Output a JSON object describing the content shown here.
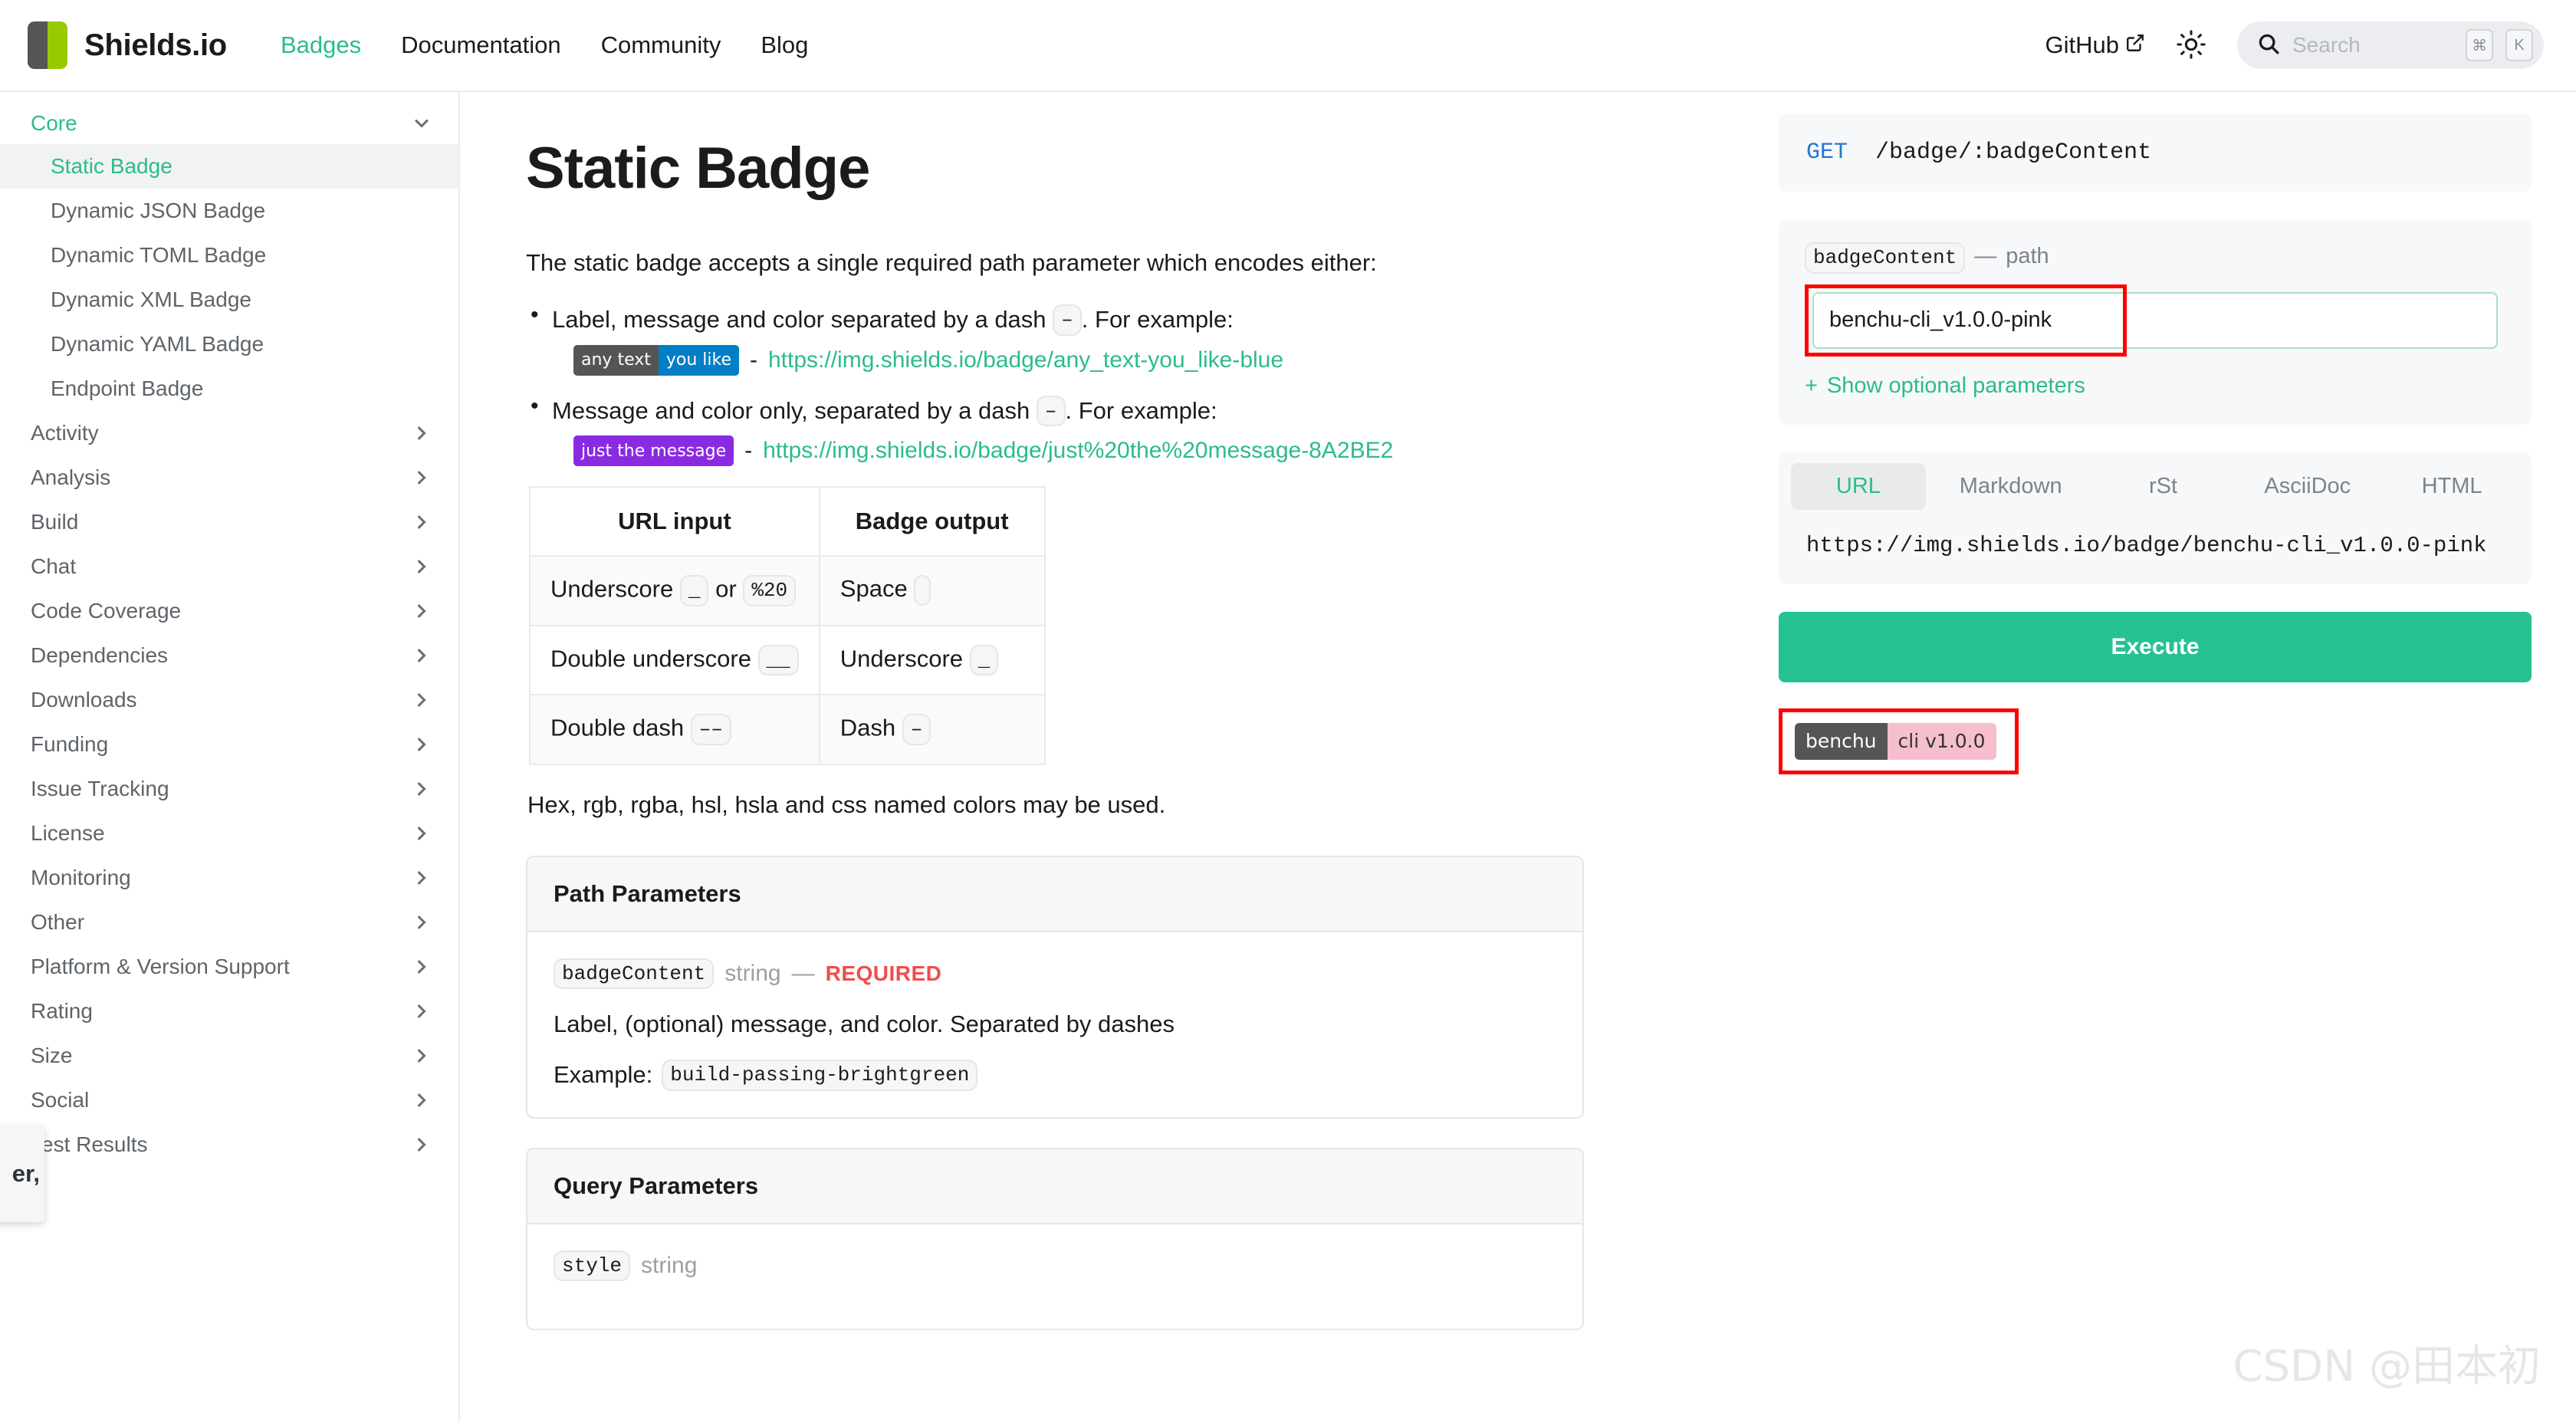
{
  "header": {
    "brand": "Shields.io",
    "nav": [
      {
        "label": "Badges",
        "active": true
      },
      {
        "label": "Documentation",
        "active": false
      },
      {
        "label": "Community",
        "active": false
      },
      {
        "label": "Blog",
        "active": false
      }
    ],
    "github_label": "GitHub",
    "search_placeholder": "Search",
    "kbd_cmd": "⌘",
    "kbd_k": "K"
  },
  "sidebar": {
    "group": {
      "label": "Core",
      "expanded": true
    },
    "items": [
      {
        "label": "Static Badge",
        "active": true
      },
      {
        "label": "Dynamic JSON Badge",
        "active": false
      },
      {
        "label": "Dynamic TOML Badge",
        "active": false
      },
      {
        "label": "Dynamic XML Badge",
        "active": false
      },
      {
        "label": "Dynamic YAML Badge",
        "active": false
      },
      {
        "label": "Endpoint Badge",
        "active": false
      }
    ],
    "categories": [
      "Activity",
      "Analysis",
      "Build",
      "Chat",
      "Code Coverage",
      "Dependencies",
      "Downloads",
      "Funding",
      "Issue Tracking",
      "License",
      "Monitoring",
      "Other",
      "Platform & Version Support",
      "Rating",
      "Size",
      "Social",
      "Test Results"
    ],
    "tooltip_fragment": "er,"
  },
  "main": {
    "title": "Static Badge",
    "lead": "The static badge accepts a single required path parameter which encodes either:",
    "bullets": [
      {
        "text_before": "Label, message and color separated by a dash",
        "code": "–",
        "text_after": ". For example:",
        "badge": {
          "type": "two-part",
          "left": "any text",
          "right": "you like",
          "left_color": "#555555",
          "right_color": "#007ec6"
        },
        "link": "https://img.shields.io/badge/any_text-you_like-blue"
      },
      {
        "text_before": "Message and color only, separated by a dash",
        "code": "–",
        "text_after": ". For example:",
        "badge": {
          "type": "one-part",
          "full": "just the message",
          "full_color": "#8a2be2"
        },
        "link": "https://img.shields.io/badge/just%20the%20message-8A2BE2"
      }
    ],
    "table": {
      "headers": [
        "URL input",
        "Badge output"
      ],
      "rows": [
        {
          "input_text": "Underscore",
          "input_code": "_",
          "input_or": "or",
          "input_code2": "%20",
          "output_text": "Space",
          "output_code": " "
        },
        {
          "input_text": "Double underscore",
          "input_code": "__",
          "input_or": "",
          "input_code2": "",
          "output_text": "Underscore",
          "output_code": "_"
        },
        {
          "input_text": "Double dash",
          "input_code": "––",
          "input_or": "",
          "input_code2": "",
          "output_text": "Dash",
          "output_code": "–"
        }
      ]
    },
    "note": "Hex, rgb, rgba, hsl, hsla and css named colors may be used.",
    "path_params": {
      "heading": "Path Parameters",
      "name": "badgeContent",
      "type": "string",
      "dash": "—",
      "required": "REQUIRED",
      "description": "Label, (optional) message, and color. Separated by dashes",
      "example_label": "Example:",
      "example_value": "build-passing-brightgreen"
    },
    "query_params": {
      "heading": "Query Parameters",
      "name": "style",
      "type": "string"
    }
  },
  "right_panel": {
    "endpoint": {
      "verb": "GET",
      "path": "/badge/:badgeContent"
    },
    "param": {
      "name": "badgeContent",
      "dash": "—",
      "kind": "path",
      "value": "benchu-cli_v1.0.0-pink",
      "show_optional": "Show optional parameters",
      "plus": "+"
    },
    "tabs": [
      {
        "label": "URL",
        "active": true
      },
      {
        "label": "Markdown",
        "active": false
      },
      {
        "label": "rSt",
        "active": false
      },
      {
        "label": "AsciiDoc",
        "active": false
      },
      {
        "label": "HTML",
        "active": false
      }
    ],
    "url_output": "https://img.shields.io/badge/benchu-cli_v1.0.0-pink",
    "execute_label": "Execute",
    "result_badge": {
      "left": "benchu",
      "right": "cli v1.0.0",
      "left_color": "#555555",
      "right_color": "#f5bfcd"
    }
  },
  "watermark": "CSDN @田本初",
  "colors": {
    "accent": "#2bbc8a",
    "execute": "#25c193",
    "highlight": "#fe0000",
    "verb": "#2478d4",
    "required": "#f14c4c"
  }
}
